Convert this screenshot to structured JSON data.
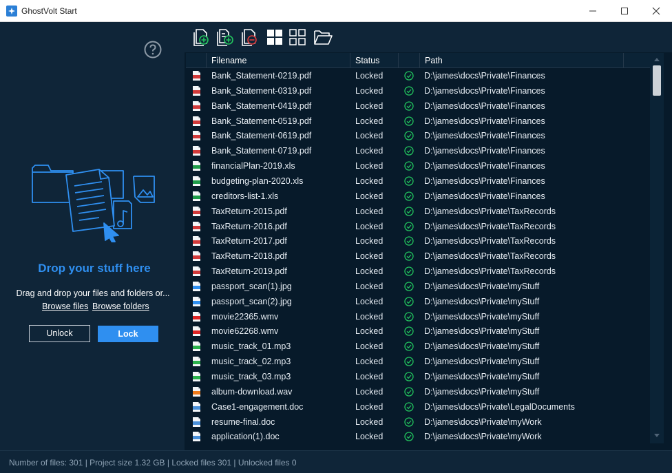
{
  "window": {
    "title": "GhostVolt Start"
  },
  "left": {
    "drop_title": "Drop your stuff here",
    "drag_text": "Drag and drop your files and folders or...",
    "browse_files": "Browse files",
    "browse_folders": "Browse folders",
    "unlock_label": "Unlock",
    "lock_label": "Lock"
  },
  "toolbar": {
    "icons": [
      "add-file-icon",
      "add-folder-files-icon",
      "remove-file-icon",
      "large-icons-view-icon",
      "grid-view-icon",
      "open-folder-icon"
    ]
  },
  "table": {
    "columns": [
      "Filename",
      "Status",
      "",
      "Path"
    ],
    "rows": [
      {
        "name": "Bank_Statement-0219.pdf",
        "status": "Locked",
        "path": "D:\\james\\docs\\Private\\Finances",
        "type": "pdf"
      },
      {
        "name": "Bank_Statement-0319.pdf",
        "status": "Locked",
        "path": "D:\\james\\docs\\Private\\Finances",
        "type": "pdf"
      },
      {
        "name": "Bank_Statement-0419.pdf",
        "status": "Locked",
        "path": "D:\\james\\docs\\Private\\Finances",
        "type": "pdf"
      },
      {
        "name": "Bank_Statement-0519.pdf",
        "status": "Locked",
        "path": "D:\\james\\docs\\Private\\Finances",
        "type": "pdf"
      },
      {
        "name": "Bank_Statement-0619.pdf",
        "status": "Locked",
        "path": "D:\\james\\docs\\Private\\Finances",
        "type": "pdf"
      },
      {
        "name": "Bank_Statement-0719.pdf",
        "status": "Locked",
        "path": "D:\\james\\docs\\Private\\Finances",
        "type": "pdf"
      },
      {
        "name": "financialPlan-2019.xls",
        "status": "Locked",
        "path": "D:\\james\\docs\\Private\\Finances",
        "type": "xls"
      },
      {
        "name": "budgeting-plan-2020.xls",
        "status": "Locked",
        "path": "D:\\james\\docs\\Private\\Finances",
        "type": "xls"
      },
      {
        "name": "creditors-list-1.xls",
        "status": "Locked",
        "path": "D:\\james\\docs\\Private\\Finances",
        "type": "xls"
      },
      {
        "name": "TaxReturn-2015.pdf",
        "status": "Locked",
        "path": "D:\\james\\docs\\Private\\TaxRecords",
        "type": "pdf"
      },
      {
        "name": "TaxReturn-2016.pdf",
        "status": "Locked",
        "path": "D:\\james\\docs\\Private\\TaxRecords",
        "type": "pdf"
      },
      {
        "name": "TaxReturn-2017.pdf",
        "status": "Locked",
        "path": "D:\\james\\docs\\Private\\TaxRecords",
        "type": "pdf"
      },
      {
        "name": "TaxReturn-2018.pdf",
        "status": "Locked",
        "path": "D:\\james\\docs\\Private\\TaxRecords",
        "type": "pdf"
      },
      {
        "name": "TaxReturn-2019.pdf",
        "status": "Locked",
        "path": "D:\\james\\docs\\Private\\TaxRecords",
        "type": "pdf"
      },
      {
        "name": "passport_scan(1).jpg",
        "status": "Locked",
        "path": "D:\\james\\docs\\Private\\myStuff",
        "type": "jpg"
      },
      {
        "name": "passport_scan(2).jpg",
        "status": "Locked",
        "path": "D:\\james\\docs\\Private\\myStuff",
        "type": "jpg"
      },
      {
        "name": "movie22365.wmv",
        "status": "Locked",
        "path": "D:\\james\\docs\\Private\\myStuff",
        "type": "wmv"
      },
      {
        "name": "movie62268.wmv",
        "status": "Locked",
        "path": "D:\\james\\docs\\Private\\myStuff",
        "type": "wmv"
      },
      {
        "name": "music_track_01.mp3",
        "status": "Locked",
        "path": "D:\\james\\docs\\Private\\myStuff",
        "type": "mp3"
      },
      {
        "name": "music_track_02.mp3",
        "status": "Locked",
        "path": "D:\\james\\docs\\Private\\myStuff",
        "type": "mp3"
      },
      {
        "name": "music_track_03.mp3",
        "status": "Locked",
        "path": "D:\\james\\docs\\Private\\myStuff",
        "type": "mp3"
      },
      {
        "name": "album-download.wav",
        "status": "Locked",
        "path": "D:\\james\\docs\\Private\\myStuff",
        "type": "wav"
      },
      {
        "name": "Case1-engagement.doc",
        "status": "Locked",
        "path": "D:\\james\\docs\\Private\\LegalDocuments",
        "type": "doc"
      },
      {
        "name": "resume-final.doc",
        "status": "Locked",
        "path": "D:\\james\\docs\\Private\\myWork",
        "type": "doc"
      },
      {
        "name": "application(1).doc",
        "status": "Locked",
        "path": "D:\\james\\docs\\Private\\myWork",
        "type": "doc"
      }
    ]
  },
  "file_type_colors": {
    "pdf": "#d23a3a",
    "xls": "#1f9d4a",
    "jpg": "#2f8ff0",
    "wmv": "#e02525",
    "mp3": "#2bb24c",
    "wav": "#f07a1a",
    "doc": "#4a90d9"
  },
  "colors": {
    "accent": "#2f8ff0",
    "locked_check": "#22c55e",
    "panel_bg": "#0f2538",
    "grid_bg": "#071a2a"
  },
  "status_bar": {
    "text": "Number of files: 301 | Project size 1.32 GB | Locked files 301 | Unlocked files 0"
  }
}
